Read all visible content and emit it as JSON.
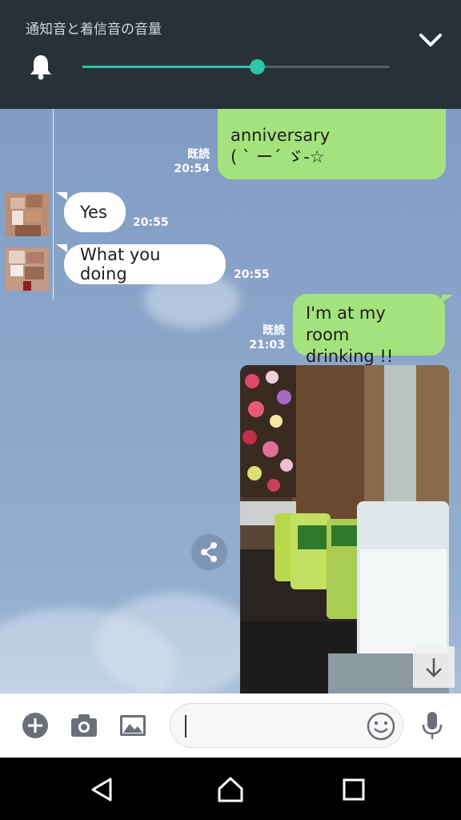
{
  "volume_panel": {
    "title": "通知音と着信音の音量",
    "level": 0.57,
    "accent_color": "#2ec4a6",
    "icons": {
      "bell": "bell-icon",
      "collapse": "chevron-down-icon"
    }
  },
  "messages": [
    {
      "direction": "out",
      "lines": [
        "anniversary",
        "( ` ー´ ゞ-☆"
      ],
      "read": "既読",
      "time": "20:54"
    },
    {
      "direction": "in",
      "text": "Yes",
      "time": "20:55"
    },
    {
      "direction": "in",
      "text": "What you doing",
      "time": "20:55"
    },
    {
      "direction": "out",
      "lines": [
        "I'm at my room",
        "drinking !!"
      ],
      "read": "既読",
      "time": "21:03"
    },
    {
      "direction": "out",
      "type": "photo",
      "description": ""
    }
  ],
  "actions": {
    "share": "share-icon",
    "scroll_down": "arrow-down-icon"
  },
  "input_bar": {
    "icons": [
      "plus-icon",
      "camera-icon",
      "image-icon",
      "emoji-icon",
      "microphone-icon"
    ],
    "value": ""
  },
  "nav_bar": {
    "icons": [
      "back-icon",
      "home-icon",
      "recents-icon"
    ]
  },
  "colors": {
    "outgoing_bubble": "#a4e27e",
    "incoming_bubble": "#ffffff",
    "chat_background": "#8aa3c5"
  }
}
